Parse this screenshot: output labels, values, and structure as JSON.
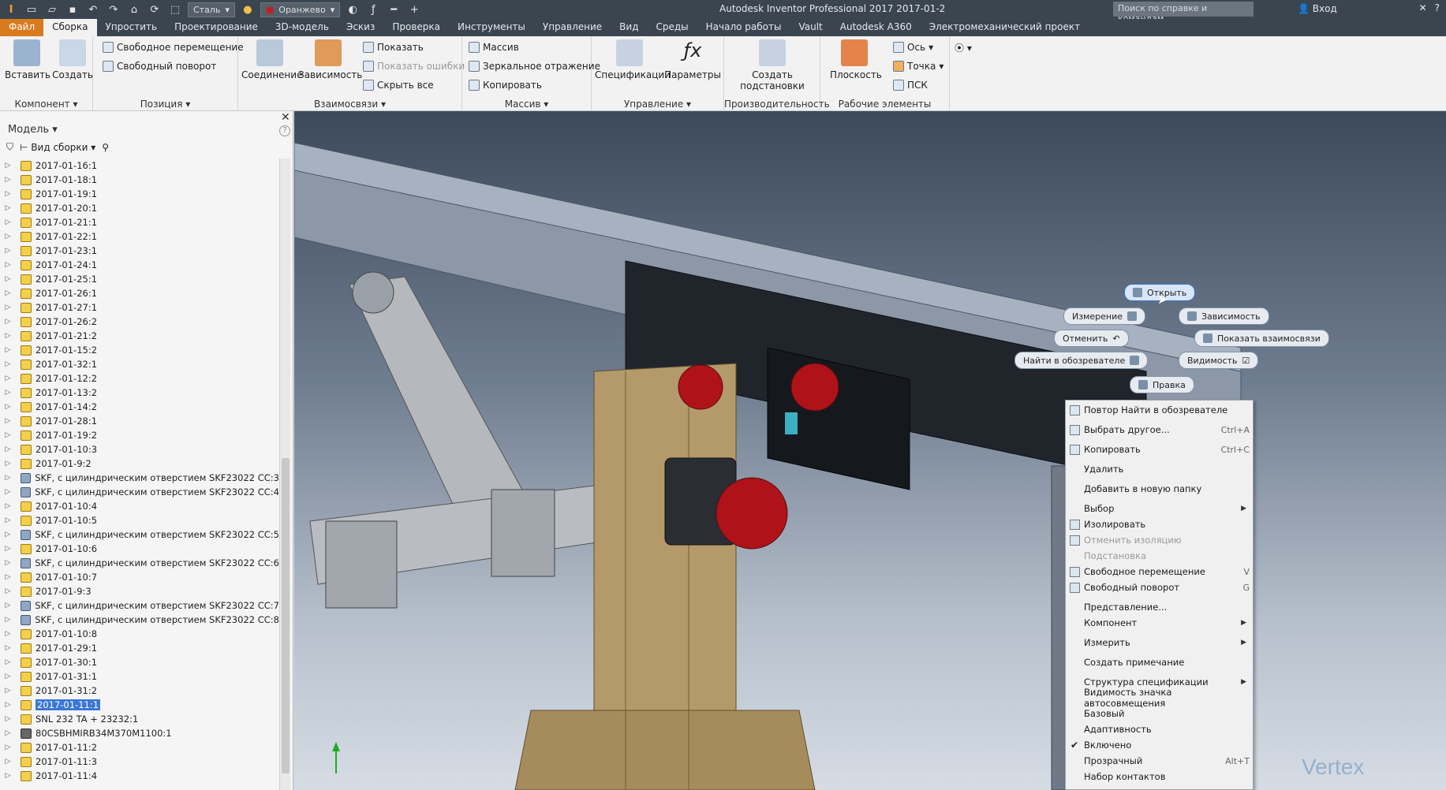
{
  "titlebar": {
    "app_title": "Autodesk Inventor Professional 2017   2017-01-2",
    "material_value": "Сталь",
    "appearance_value": "Оранжево",
    "help_search_placeholder": "Поиск по справке и командам",
    "login_label": "Вход"
  },
  "tabs": [
    "Файл",
    "Сборка",
    "Упростить",
    "Проектирование",
    "3D-модель",
    "Эскиз",
    "Проверка",
    "Инструменты",
    "Управление",
    "Вид",
    "Среды",
    "Начало работы",
    "Vault",
    "Autodesk A360",
    "Электромеханический проект"
  ],
  "ribbon": {
    "component": {
      "title": "Компонент",
      "insert": "Вставить",
      "create": "Создать"
    },
    "position": {
      "title": "Позиция",
      "free_move": "Свободное перемещение",
      "free_rotate": "Свободный поворот"
    },
    "relations": {
      "title": "Взаимосвязи",
      "joint": "Соединение",
      "constraint": "Зависимость",
      "show": "Показать",
      "show_errors": "Показать ошибки",
      "hide_all": "Скрыть все"
    },
    "pattern": {
      "title": "Массив",
      "pattern": "Массив",
      "mirror": "Зеркальное отражение",
      "copy": "Копировать"
    },
    "manage": {
      "title": "Управление",
      "bom": "Спецификации",
      "params": "Параметры"
    },
    "productivity": {
      "title": "Производительность",
      "substitutes": "Создать подстановки"
    },
    "workfeatures": {
      "title": "Рабочие элементы",
      "plane": "Плоскость",
      "axis": "Ось",
      "point": "Точка",
      "ucs": "ПСК"
    }
  },
  "browser": {
    "title": "Модель",
    "view": "Вид сборки",
    "items": [
      {
        "label": "2017-01-16:1",
        "type": "part"
      },
      {
        "label": "2017-01-18:1",
        "type": "part"
      },
      {
        "label": "2017-01-19:1",
        "type": "part"
      },
      {
        "label": "2017-01-20:1",
        "type": "part"
      },
      {
        "label": "2017-01-21:1",
        "type": "part"
      },
      {
        "label": "2017-01-22:1",
        "type": "part"
      },
      {
        "label": "2017-01-23:1",
        "type": "part"
      },
      {
        "label": "2017-01-24:1",
        "type": "part"
      },
      {
        "label": "2017-01-25:1",
        "type": "part"
      },
      {
        "label": "2017-01-26:1",
        "type": "part"
      },
      {
        "label": "2017-01-27:1",
        "type": "part"
      },
      {
        "label": "2017-01-26:2",
        "type": "part"
      },
      {
        "label": "2017-01-21:2",
        "type": "part"
      },
      {
        "label": "2017-01-15:2",
        "type": "part"
      },
      {
        "label": "2017-01-32:1",
        "type": "part"
      },
      {
        "label": "2017-01-12:2",
        "type": "part"
      },
      {
        "label": "2017-01-13:2",
        "type": "part"
      },
      {
        "label": "2017-01-14:2",
        "type": "part"
      },
      {
        "label": "2017-01-28:1",
        "type": "part"
      },
      {
        "label": "2017-01-19:2",
        "type": "part"
      },
      {
        "label": "2017-01-10:3",
        "type": "part"
      },
      {
        "label": "2017-01-9:2",
        "type": "part"
      },
      {
        "label": "SKF, с цилиндрическим отверстием SKF23022 CC:3",
        "type": "bearing"
      },
      {
        "label": "SKF, с цилиндрическим отверстием SKF23022 CC:4",
        "type": "bearing"
      },
      {
        "label": "2017-01-10:4",
        "type": "part"
      },
      {
        "label": "2017-01-10:5",
        "type": "part"
      },
      {
        "label": "SKF, с цилиндрическим отверстием SKF23022 CC:5",
        "type": "bearing"
      },
      {
        "label": "2017-01-10:6",
        "type": "part"
      },
      {
        "label": "SKF, с цилиндрическим отверстием SKF23022 CC:6",
        "type": "bearing"
      },
      {
        "label": "2017-01-10:7",
        "type": "part"
      },
      {
        "label": "2017-01-9:3",
        "type": "part"
      },
      {
        "label": "SKF, с цилиндрическим отверстием SKF23022 CC:7",
        "type": "bearing"
      },
      {
        "label": "SKF, с цилиндрическим отверстием SKF23022 CC:8",
        "type": "bearing"
      },
      {
        "label": "2017-01-10:8",
        "type": "part"
      },
      {
        "label": "2017-01-29:1",
        "type": "part"
      },
      {
        "label": "2017-01-30:1",
        "type": "part"
      },
      {
        "label": "2017-01-31:1",
        "type": "part"
      },
      {
        "label": "2017-01-31:2",
        "type": "part"
      },
      {
        "label": "2017-01-11:1",
        "type": "part",
        "selected": true
      },
      {
        "label": "SNL 232 TA + 23232:1",
        "type": "part"
      },
      {
        "label": "80CSBHMIRB34M370M1100:1",
        "type": "asm"
      },
      {
        "label": "2017-01-11:2",
        "type": "part"
      },
      {
        "label": "2017-01-11:3",
        "type": "part"
      },
      {
        "label": "2017-01-11:4",
        "type": "part"
      }
    ]
  },
  "marking_menu": {
    "open": "Открыть",
    "measure": "Измерение",
    "constraint": "Зависимость",
    "undo": "Отменить",
    "show_relations": "Показать взаимосвязи",
    "find_in_browser": "Найти в обозревателе",
    "visibility": "Видимость",
    "edit": "Правка"
  },
  "context_menu": [
    {
      "label": "Повтор Найти в обозревателе",
      "icon": true
    },
    {
      "label": "Выбрать другое...",
      "shortcut": "Ctrl+A",
      "icon": true
    },
    {
      "label": "Копировать",
      "shortcut": "Ctrl+C",
      "icon": true
    },
    {
      "label": "Удалить"
    },
    {
      "label": "Добавить в новую папку"
    },
    {
      "label": "Выбор",
      "submenu": true
    },
    {
      "label": "Изолировать",
      "icon": true
    },
    {
      "label": "Отменить изоляцию",
      "disabled": true,
      "icon": true
    },
    {
      "label": "Подстановка",
      "disabled": true
    },
    {
      "label": "Свободное перемещение",
      "shortcut": "V",
      "icon": true
    },
    {
      "label": "Свободный поворот",
      "shortcut": "G",
      "icon": true
    },
    {
      "label": "Представление..."
    },
    {
      "label": "Компонент",
      "submenu": true
    },
    {
      "label": "Измерить",
      "submenu": true
    },
    {
      "label": "Создать примечание"
    },
    {
      "label": "Структура спецификации",
      "submenu": true
    },
    {
      "label": "Видимость значка автосовмещения"
    },
    {
      "label": "Базовый"
    },
    {
      "label": "Адаптивность"
    },
    {
      "label": "Включено",
      "checked": true
    },
    {
      "label": "Прозрачный",
      "shortcut": "Alt+T"
    },
    {
      "label": "Набор контактов"
    }
  ],
  "watermark": "Vertex",
  "colors": {
    "file_tab": "#d87a1e",
    "titlebar": "#3a4550",
    "selection": "#3b77d8",
    "sprocket": "#b0121a",
    "frame_tan": "#b49a6a"
  }
}
